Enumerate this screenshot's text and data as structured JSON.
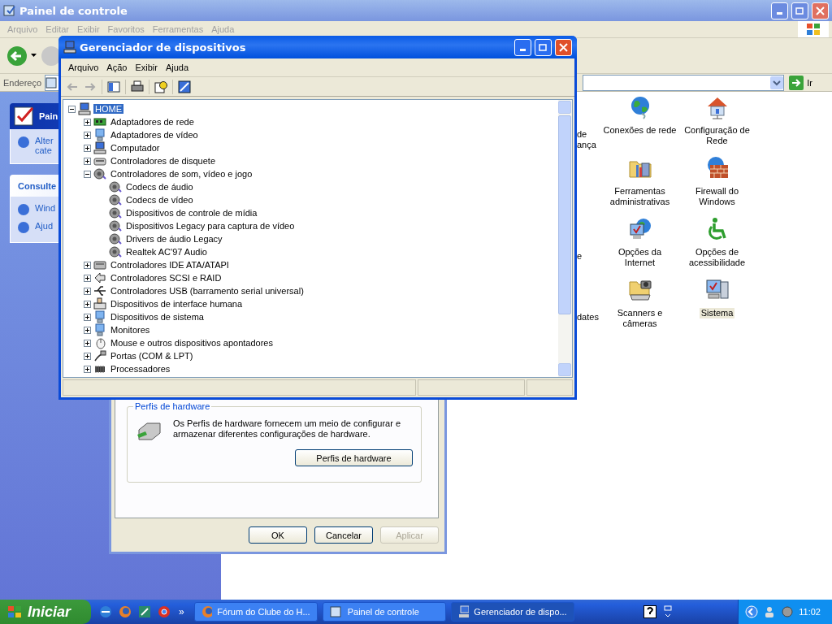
{
  "control_panel": {
    "title": "Painel de controle",
    "menu": [
      "Arquivo",
      "Editar",
      "Exibir",
      "Favoritos",
      "Ferramentas",
      "Ajuda"
    ],
    "address": {
      "label": "Endereço",
      "go": "Ir"
    },
    "side_panels": [
      {
        "kind": "main",
        "title": "Pain",
        "links": [
          {
            "lines": [
              "Alter",
              "cate"
            ]
          }
        ]
      },
      {
        "kind": "see_also",
        "title": "Consulte",
        "links": [
          {
            "lines": [
              "Wind"
            ]
          },
          {
            "lines": [
              "Ajud"
            ]
          }
        ]
      }
    ],
    "icon_rows": [
      {
        "cut_label": [
          "de",
          "ança"
        ],
        "icons": [
          {
            "kind": "network",
            "label": "Conexões de rede",
            "selected": false
          },
          {
            "kind": "home",
            "label": "Configuração de Rede",
            "selected": false
          }
        ]
      },
      {
        "icons": [
          {
            "kind": "tools",
            "label": "Ferramentas administrativas",
            "selected": false
          },
          {
            "kind": "firewall",
            "label": "Firewall do Windows",
            "selected": false
          }
        ]
      },
      {
        "cut_label": [
          "e"
        ],
        "icons": [
          {
            "kind": "internet",
            "label": "Opções da Internet",
            "selected": false
          },
          {
            "kind": "access",
            "label": "Opções de acessibilidade",
            "selected": false
          }
        ]
      },
      {
        "cut_label": [
          "dates"
        ],
        "icons": [
          {
            "kind": "scanner",
            "label": "Scanners e câmeras",
            "selected": false
          },
          {
            "kind": "system",
            "label": "Sistema",
            "selected": true
          }
        ]
      }
    ]
  },
  "system_dialog": {
    "group_title": "Perfis de hardware",
    "text": "Os Perfis de hardware fornecem um meio de configurar e armazenar diferentes configurações de hardware.",
    "group_button": "Perfis de hardware",
    "buttons": [
      {
        "label": "OK",
        "disabled": false
      },
      {
        "label": "Cancelar",
        "disabled": false
      },
      {
        "label": "Aplicar",
        "disabled": true
      }
    ]
  },
  "device_manager": {
    "title": "Gerenciador de dispositivos",
    "menu": [
      "Arquivo",
      "Ação",
      "Exibir",
      "Ajuda"
    ],
    "tree": {
      "kind": "computer",
      "label": "HOME",
      "expanded": true,
      "selected": true,
      "children": [
        {
          "kind": "network",
          "label": "Adaptadores de rede",
          "expanded": false,
          "selected": false
        },
        {
          "kind": "display",
          "label": "Adaptadores de vídeo",
          "expanded": false,
          "selected": false
        },
        {
          "kind": "computer",
          "label": "Computador",
          "expanded": false,
          "selected": false
        },
        {
          "kind": "floppy",
          "label": "Controladores de disquete",
          "expanded": false,
          "selected": false
        },
        {
          "kind": "sound",
          "label": "Controladores de som, vídeo e jogo",
          "expanded": true,
          "selected": false,
          "children": [
            {
              "kind": "sound",
              "label": "Codecs de áudio",
              "selected": false
            },
            {
              "kind": "sound",
              "label": "Codecs de vídeo",
              "selected": false
            },
            {
              "kind": "sound",
              "label": "Dispositivos de controle de mídia",
              "selected": false
            },
            {
              "kind": "sound",
              "label": "Dispositivos Legacy para captura de vídeo",
              "selected": false
            },
            {
              "kind": "sound",
              "label": "Drivers de áudio Legacy",
              "selected": false
            },
            {
              "kind": "sound",
              "label": "Realtek AC'97 Audio",
              "selected": false
            }
          ]
        },
        {
          "kind": "ide",
          "label": "Controladores IDE ATA/ATAPI",
          "expanded": false,
          "selected": false
        },
        {
          "kind": "scsi",
          "label": "Controladores SCSI e RAID",
          "expanded": false,
          "selected": false
        },
        {
          "kind": "usb",
          "label": "Controladores USB (barramento serial universal)",
          "expanded": false,
          "selected": false
        },
        {
          "kind": "hid",
          "label": "Dispositivos de interface humana",
          "expanded": false,
          "selected": false
        },
        {
          "kind": "display",
          "label": "Dispositivos de sistema",
          "expanded": false,
          "selected": false
        },
        {
          "kind": "display",
          "label": "Monitores",
          "expanded": false,
          "selected": false
        },
        {
          "kind": "mouse",
          "label": "Mouse e outros dispositivos apontadores",
          "expanded": false,
          "selected": false
        },
        {
          "kind": "port",
          "label": "Portas (COM & LPT)",
          "expanded": false,
          "selected": false
        },
        {
          "kind": "cpu",
          "label": "Processadores",
          "expanded": false,
          "selected": false
        }
      ]
    }
  },
  "taskbar": {
    "start": "Iniciar",
    "more": "»",
    "tasks": [
      {
        "kind": "browser",
        "label": "Fórum do Clube do H...",
        "selected": false
      },
      {
        "kind": "panel",
        "label": "Painel de controle",
        "selected": false
      },
      {
        "kind": "computer",
        "label": "Gerenciador de dispo...",
        "selected": true
      }
    ],
    "clock": "11:02"
  }
}
